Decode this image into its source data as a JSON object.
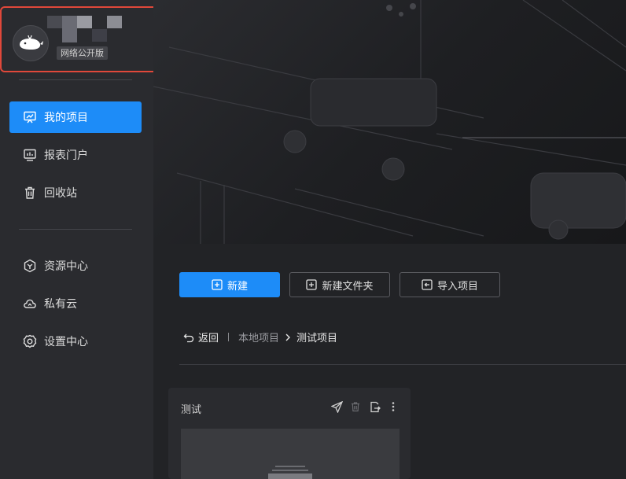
{
  "profile": {
    "edition": "网络公开版"
  },
  "sidebar": {
    "items": [
      {
        "label": "我的项目",
        "icon": "presentation-icon"
      },
      {
        "label": "报表门户",
        "icon": "report-icon"
      },
      {
        "label": "回收站",
        "icon": "trash-icon"
      },
      {
        "label": "资源中心",
        "icon": "hexagon-icon"
      },
      {
        "label": "私有云",
        "icon": "cloud-icon"
      },
      {
        "label": "设置中心",
        "icon": "gear-icon"
      }
    ]
  },
  "toolbar": {
    "new_label": "新建",
    "new_folder_label": "新建文件夹",
    "import_label": "导入项目"
  },
  "breadcrumb": {
    "back": "返回",
    "local": "本地项目",
    "current": "测试项目"
  },
  "card": {
    "title": "测试",
    "actions": [
      "send-icon",
      "trash-icon",
      "export-icon",
      "more-icon"
    ]
  },
  "colors": {
    "accent": "#1d8cf8",
    "highlight_border": "#e0483a",
    "sidebar_bg": "#2a2b2f"
  }
}
